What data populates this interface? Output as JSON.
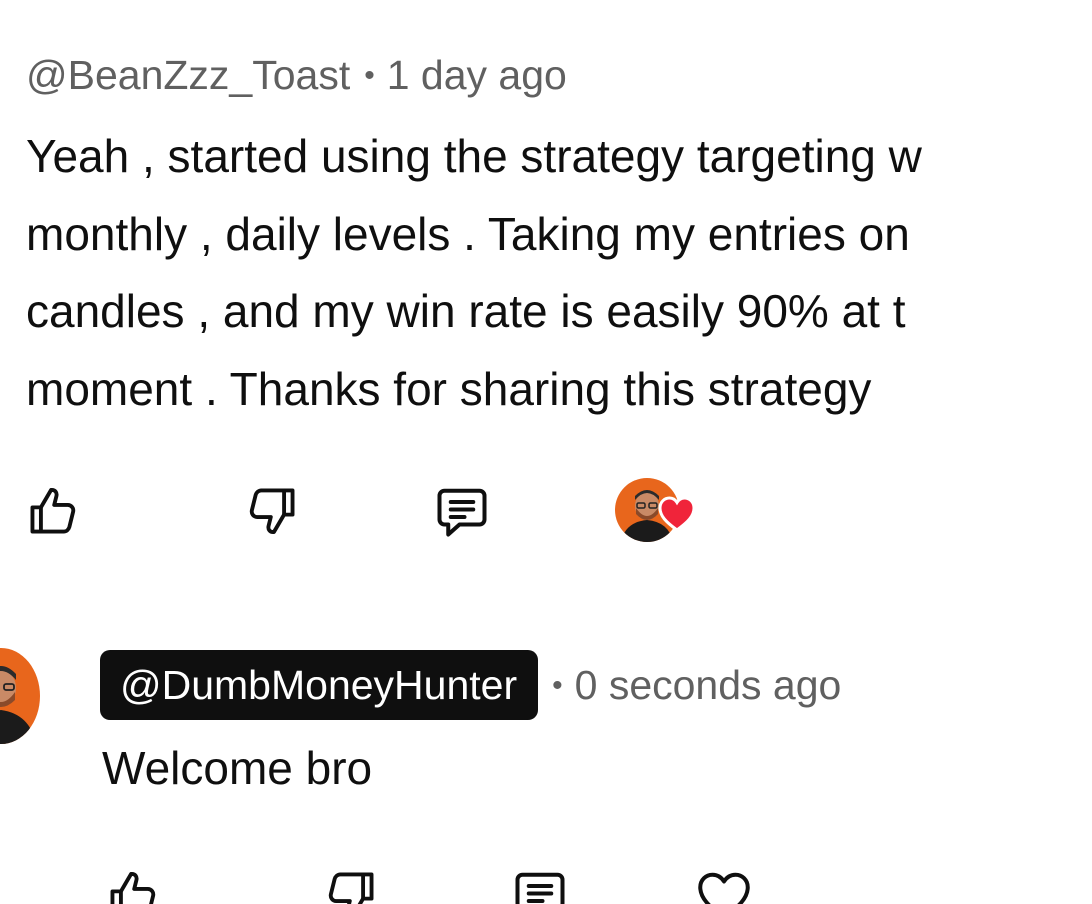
{
  "comments": [
    {
      "author": "@BeanZzz_Toast",
      "separator": "•",
      "time": "1 day ago",
      "body_lines": [
        "Yeah , started using the strategy targeting w",
        "monthly , daily levels . Taking my entries on",
        "candles , and my win rate is easily 90% at t",
        "moment . Thanks for sharing this strategy"
      ],
      "creator_hearted": true,
      "icons": [
        "thumb-up-icon",
        "thumb-down-icon",
        "reply-icon",
        "creator-avatar",
        "heart-icon"
      ]
    },
    {
      "author": "@DumbMoneyHunter",
      "author_is_creator": true,
      "separator": "•",
      "time": "0 seconds ago",
      "body": "Welcome bro",
      "icons": [
        "thumb-up-icon",
        "thumb-down-icon",
        "reply-icon",
        "heart-outline-icon"
      ]
    }
  ],
  "colors": {
    "text": "#0f0f0f",
    "meta": "#606060",
    "handle_pill_bg": "#0f0f0f",
    "heart": "#f0243a",
    "avatar_bg": "#e8661c"
  }
}
